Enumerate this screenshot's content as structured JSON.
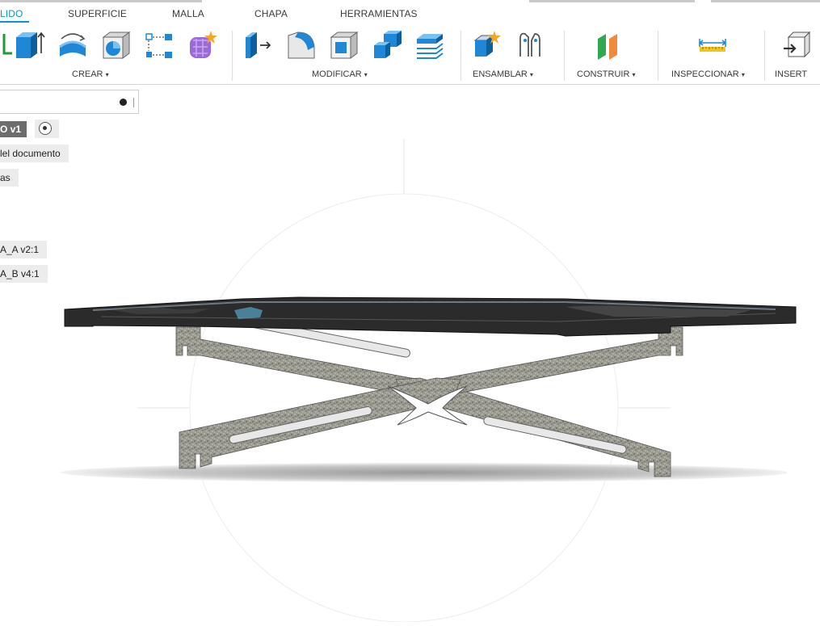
{
  "toolbar": {
    "tabs": [
      {
        "label": "LIDO",
        "active": true
      },
      {
        "label": "SUPERFICIE",
        "active": false
      },
      {
        "label": "MALLA",
        "active": false
      },
      {
        "label": "CHAPA",
        "active": false
      },
      {
        "label": "HERRAMIENTAS",
        "active": false
      }
    ],
    "groups": [
      {
        "label": "CREAR",
        "caret": "▾"
      },
      {
        "label": "MODIFICAR",
        "caret": "▾"
      },
      {
        "label": "ENSAMBLAR",
        "caret": "▾"
      },
      {
        "label": "CONSTRUIR",
        "caret": "▾"
      },
      {
        "label": "INSPECCIONAR",
        "caret": "▾"
      },
      {
        "label": "INSERT",
        "caret": ""
      }
    ],
    "tools": [
      "sketch-icon",
      "extrude-icon",
      "revolve-icon",
      "shell-icon",
      "pattern-icon",
      "create-form-icon",
      "press-pull-icon",
      "fillet-icon",
      "shell-modify-icon",
      "combine-icon",
      "offset-face-icon",
      "new-component-icon",
      "joint-icon",
      "offset-plane-icon",
      "measure-icon",
      "insert-icon"
    ],
    "accent": "#0696d7"
  },
  "browser": {
    "root_label": "O v1",
    "items": [
      {
        "label": "lel documento"
      },
      {
        "label": "as"
      },
      {
        "label": "A_A v2:1"
      },
      {
        "label": "A_B v4:1"
      }
    ]
  },
  "viewport": {
    "model": "scissor-table",
    "background": "#ffffff"
  }
}
